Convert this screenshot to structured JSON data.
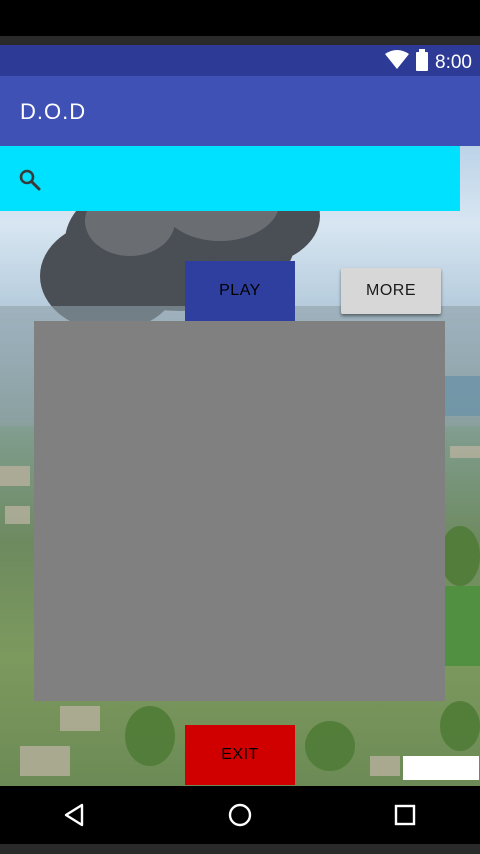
{
  "status_bar": {
    "time": "8:00",
    "icons": [
      "wifi-icon",
      "battery-icon"
    ]
  },
  "app_bar": {
    "title": "D.O.D"
  },
  "search": {
    "icon": "search-icon"
  },
  "buttons": {
    "play": "PLAY",
    "more": "MORE",
    "exit": "EXIT"
  },
  "colors": {
    "status_bar": "#2d3a96",
    "app_bar": "#3f51b5",
    "search_bar": "#00e0ff",
    "play_button": "#2e3f9f",
    "more_button": "#d7d7d7",
    "exit_button": "#d10000",
    "panel": "#808080"
  },
  "navigation": {
    "back": "back-icon",
    "home": "home-icon",
    "recents": "recents-icon"
  }
}
